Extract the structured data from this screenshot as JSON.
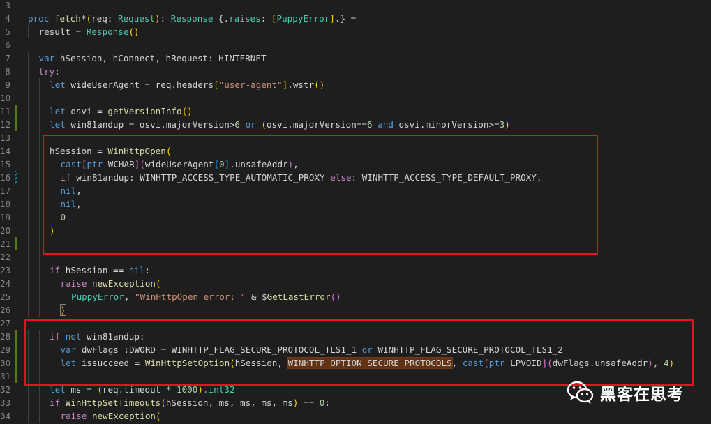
{
  "colors": {
    "background": "#1e1e1e",
    "keyword": "#569cd6",
    "control_keyword": "#c586c0",
    "function": "#dcdcaa",
    "type": "#4ec9b0",
    "string": "#ce9178",
    "number": "#b5cea8",
    "bracket_gold": "#ffd700",
    "bracket_pink": "#da70d6",
    "bracket_blue": "#179fff",
    "line_number": "#858585",
    "annotation_box": "#e81123",
    "git_added": "#587c0c",
    "git_modified": "#0c7d9d"
  },
  "editor": {
    "lines": [
      {
        "num": "3",
        "indent": 0,
        "tokens": []
      },
      {
        "num": "4",
        "indent": 0,
        "tokens": [
          {
            "t": "proc ",
            "c": "keyword"
          },
          {
            "t": "fetch",
            "c": "function"
          },
          {
            "t": "*",
            "c": "default"
          },
          {
            "t": "(",
            "c": "bracket_gold"
          },
          {
            "t": "req",
            "c": "default"
          },
          {
            "t": ": ",
            "c": "default"
          },
          {
            "t": "Request",
            "c": "type"
          },
          {
            "t": ")",
            "c": "bracket_gold"
          },
          {
            "t": ": ",
            "c": "default"
          },
          {
            "t": "Response",
            "c": "type"
          },
          {
            "t": " {.",
            "c": "default"
          },
          {
            "t": "raises",
            "c": "type"
          },
          {
            "t": ": ",
            "c": "default"
          },
          {
            "t": "[",
            "c": "bracket_gold"
          },
          {
            "t": "PuppyError",
            "c": "type"
          },
          {
            "t": "]",
            "c": "bracket_gold"
          },
          {
            "t": ".} =",
            "c": "default"
          }
        ]
      },
      {
        "num": "5",
        "indent": 1,
        "tokens": [
          {
            "t": "result = ",
            "c": "default"
          },
          {
            "t": "Response",
            "c": "type"
          },
          {
            "t": "(",
            "c": "bracket_gold"
          },
          {
            "t": ")",
            "c": "bracket_gold"
          }
        ]
      },
      {
        "num": "6",
        "indent": 0,
        "tokens": []
      },
      {
        "num": "7",
        "indent": 1,
        "tokens": [
          {
            "t": "var ",
            "c": "keyword"
          },
          {
            "t": "hSession, hConnect, hRequest: HINTERNET",
            "c": "default"
          }
        ]
      },
      {
        "num": "8",
        "indent": 1,
        "tokens": [
          {
            "t": "try",
            "c": "control_keyword"
          },
          {
            "t": ":",
            "c": "default"
          }
        ]
      },
      {
        "num": "9",
        "indent": 2,
        "tokens": [
          {
            "t": "let ",
            "c": "keyword"
          },
          {
            "t": "wideUserAgent = req.headers",
            "c": "default"
          },
          {
            "t": "[",
            "c": "bracket_gold"
          },
          {
            "t": "\"user-agent\"",
            "c": "string"
          },
          {
            "t": "]",
            "c": "bracket_gold"
          },
          {
            "t": ".wstr",
            "c": "default"
          },
          {
            "t": "(",
            "c": "bracket_gold"
          },
          {
            "t": ")",
            "c": "bracket_gold"
          }
        ]
      },
      {
        "num": "10",
        "indent": 2,
        "tokens": []
      },
      {
        "num": "11",
        "indent": 2,
        "bar": "added",
        "tokens": [
          {
            "t": "let ",
            "c": "keyword"
          },
          {
            "t": "osvi = ",
            "c": "default"
          },
          {
            "t": "getVersionInfo",
            "c": "function"
          },
          {
            "t": "(",
            "c": "bracket_gold"
          },
          {
            "t": ")",
            "c": "bracket_gold"
          }
        ]
      },
      {
        "num": "12",
        "indent": 2,
        "bar": "added",
        "tokens": [
          {
            "t": "let ",
            "c": "keyword"
          },
          {
            "t": "win81andup = osvi.majorVersion>",
            "c": "default"
          },
          {
            "t": "6",
            "c": "number"
          },
          {
            "t": " ",
            "c": "default"
          },
          {
            "t": "or",
            "c": "keyword"
          },
          {
            "t": " ",
            "c": "default"
          },
          {
            "t": "(",
            "c": "bracket_gold"
          },
          {
            "t": "osvi.majorVersion==",
            "c": "default"
          },
          {
            "t": "6",
            "c": "number"
          },
          {
            "t": " ",
            "c": "default"
          },
          {
            "t": "and",
            "c": "keyword"
          },
          {
            "t": " osvi.minorVersion>=",
            "c": "default"
          },
          {
            "t": "3",
            "c": "number"
          },
          {
            "t": ")",
            "c": "bracket_gold"
          }
        ]
      },
      {
        "num": "13",
        "indent": 2,
        "tokens": []
      },
      {
        "num": "14",
        "indent": 2,
        "tokens": [
          {
            "t": "hSession = ",
            "c": "default"
          },
          {
            "t": "WinHttpOpen",
            "c": "function"
          },
          {
            "t": "(",
            "c": "bracket_gold"
          }
        ]
      },
      {
        "num": "15",
        "indent": 3,
        "tokens": [
          {
            "t": "cast",
            "c": "keyword"
          },
          {
            "t": "[",
            "c": "bracket_pink"
          },
          {
            "t": "ptr",
            "c": "keyword"
          },
          {
            "t": " WCHAR",
            "c": "default"
          },
          {
            "t": "]",
            "c": "bracket_pink"
          },
          {
            "t": "(",
            "c": "bracket_pink"
          },
          {
            "t": "wideUserAgent",
            "c": "default"
          },
          {
            "t": "[",
            "c": "bracket_blue"
          },
          {
            "t": "0",
            "c": "number"
          },
          {
            "t": "]",
            "c": "bracket_blue"
          },
          {
            "t": ".unsafeAddr",
            "c": "default"
          },
          {
            "t": ")",
            "c": "bracket_pink"
          },
          {
            "t": ",",
            "c": "default"
          }
        ]
      },
      {
        "num": "16",
        "indent": 3,
        "bar": "modified-hatched",
        "tokens": [
          {
            "t": "if",
            "c": "control_keyword"
          },
          {
            "t": " win81andup: WINHTTP_ACCESS_TYPE_AUTOMATIC_PROXY ",
            "c": "default"
          },
          {
            "t": "else",
            "c": "control_keyword"
          },
          {
            "t": ": WINHTTP_ACCESS_TYPE_DEFAULT_PROXY,",
            "c": "default"
          }
        ]
      },
      {
        "num": "17",
        "indent": 3,
        "tokens": [
          {
            "t": "nil",
            "c": "keyword"
          },
          {
            "t": ",",
            "c": "default"
          }
        ]
      },
      {
        "num": "18",
        "indent": 3,
        "tokens": [
          {
            "t": "nil",
            "c": "keyword"
          },
          {
            "t": ",",
            "c": "default"
          }
        ]
      },
      {
        "num": "19",
        "indent": 3,
        "tokens": [
          {
            "t": "0",
            "c": "number"
          }
        ]
      },
      {
        "num": "20",
        "indent": 2,
        "tokens": [
          {
            "t": ")",
            "c": "bracket_gold"
          }
        ]
      },
      {
        "num": "21",
        "indent": 2,
        "bar": "added",
        "tokens": []
      },
      {
        "num": "22",
        "indent": 2,
        "tokens": []
      },
      {
        "num": "23",
        "indent": 2,
        "tokens": [
          {
            "t": "if",
            "c": "control_keyword"
          },
          {
            "t": " hSession == ",
            "c": "default"
          },
          {
            "t": "nil",
            "c": "keyword"
          },
          {
            "t": ":",
            "c": "default"
          }
        ]
      },
      {
        "num": "24",
        "indent": 3,
        "tokens": [
          {
            "t": "raise",
            "c": "control_keyword"
          },
          {
            "t": " ",
            "c": "default"
          },
          {
            "t": "newException",
            "c": "function"
          },
          {
            "t": "(",
            "c": "bracket_gold"
          }
        ]
      },
      {
        "num": "25",
        "indent": 4,
        "tokens": [
          {
            "t": "PuppyError",
            "c": "type"
          },
          {
            "t": ", ",
            "c": "default"
          },
          {
            "t": "\"WinHttpOpen error: \"",
            "c": "string"
          },
          {
            "t": " & $",
            "c": "default"
          },
          {
            "t": "GetLastError",
            "c": "function"
          },
          {
            "t": "(",
            "c": "bracket_pink"
          },
          {
            "t": ")",
            "c": "bracket_pink"
          }
        ]
      },
      {
        "num": "26",
        "indent": 3,
        "tokens": [
          {
            "t": ")",
            "c": "bracket_gold",
            "match": true
          }
        ]
      },
      {
        "num": "27",
        "indent": 0,
        "tokens": []
      },
      {
        "num": "28",
        "indent": 2,
        "bar": "added",
        "tokens": [
          {
            "t": "if",
            "c": "control_keyword"
          },
          {
            "t": " ",
            "c": "default"
          },
          {
            "t": "not",
            "c": "keyword"
          },
          {
            "t": " win81andup:",
            "c": "default"
          }
        ]
      },
      {
        "num": "29",
        "indent": 3,
        "bar": "added",
        "tokens": [
          {
            "t": "var ",
            "c": "keyword"
          },
          {
            "t": "dwFlags :DWORD = WINHTTP_FLAG_SECURE_PROTOCOL_TLS1_1 ",
            "c": "default"
          },
          {
            "t": "or",
            "c": "keyword"
          },
          {
            "t": " WINHTTP_FLAG_SECURE_PROTOCOL_TLS1_2",
            "c": "default"
          }
        ]
      },
      {
        "num": "30",
        "indent": 3,
        "bar": "added",
        "tokens": [
          {
            "t": "let ",
            "c": "keyword"
          },
          {
            "t": "issucceed = ",
            "c": "default"
          },
          {
            "t": "WinHttpSetOption",
            "c": "function"
          },
          {
            "t": "(",
            "c": "bracket_gold"
          },
          {
            "t": "hSession, ",
            "c": "default"
          },
          {
            "t": "WINHTTP_OPTION_SECURE_PROTOCOLS",
            "c": "default",
            "hl": true
          },
          {
            "t": ", ",
            "c": "default"
          },
          {
            "t": "cast",
            "c": "keyword"
          },
          {
            "t": "[",
            "c": "bracket_pink"
          },
          {
            "t": "ptr",
            "c": "keyword"
          },
          {
            "t": " LPVOID",
            "c": "default"
          },
          {
            "t": "]",
            "c": "bracket_pink"
          },
          {
            "t": "(",
            "c": "bracket_pink"
          },
          {
            "t": "dwFlags.unsafeAddr",
            "c": "default"
          },
          {
            "t": ")",
            "c": "bracket_pink"
          },
          {
            "t": ", ",
            "c": "default"
          },
          {
            "t": "4",
            "c": "number"
          },
          {
            "t": ")",
            "c": "bracket_gold"
          }
        ]
      },
      {
        "num": "31",
        "indent": 2,
        "bar": "added",
        "tokens": []
      },
      {
        "num": "32",
        "indent": 2,
        "tokens": [
          {
            "t": "let ",
            "c": "keyword"
          },
          {
            "t": "ms = ",
            "c": "default"
          },
          {
            "t": "(",
            "c": "bracket_gold"
          },
          {
            "t": "req.timeout * ",
            "c": "default"
          },
          {
            "t": "1000",
            "c": "number"
          },
          {
            "t": ")",
            "c": "bracket_gold"
          },
          {
            "t": ".int32",
            "c": "type"
          }
        ]
      },
      {
        "num": "33",
        "indent": 2,
        "tokens": [
          {
            "t": "if",
            "c": "control_keyword"
          },
          {
            "t": " ",
            "c": "default"
          },
          {
            "t": "WinHttpSetTimeouts",
            "c": "function"
          },
          {
            "t": "(",
            "c": "bracket_gold"
          },
          {
            "t": "hSession, ms, ms, ms, ms",
            "c": "default"
          },
          {
            "t": ")",
            "c": "bracket_gold"
          },
          {
            "t": " == ",
            "c": "default"
          },
          {
            "t": "0",
            "c": "number"
          },
          {
            "t": ":",
            "c": "default"
          }
        ]
      },
      {
        "num": "34",
        "indent": 3,
        "tokens": [
          {
            "t": "raise",
            "c": "control_keyword"
          },
          {
            "t": " ",
            "c": "default"
          },
          {
            "t": "newException",
            "c": "function"
          },
          {
            "t": "(",
            "c": "bracket_gold"
          }
        ]
      }
    ]
  },
  "watermark": {
    "icon": "wechat-icon",
    "text": "黑客在思考"
  }
}
